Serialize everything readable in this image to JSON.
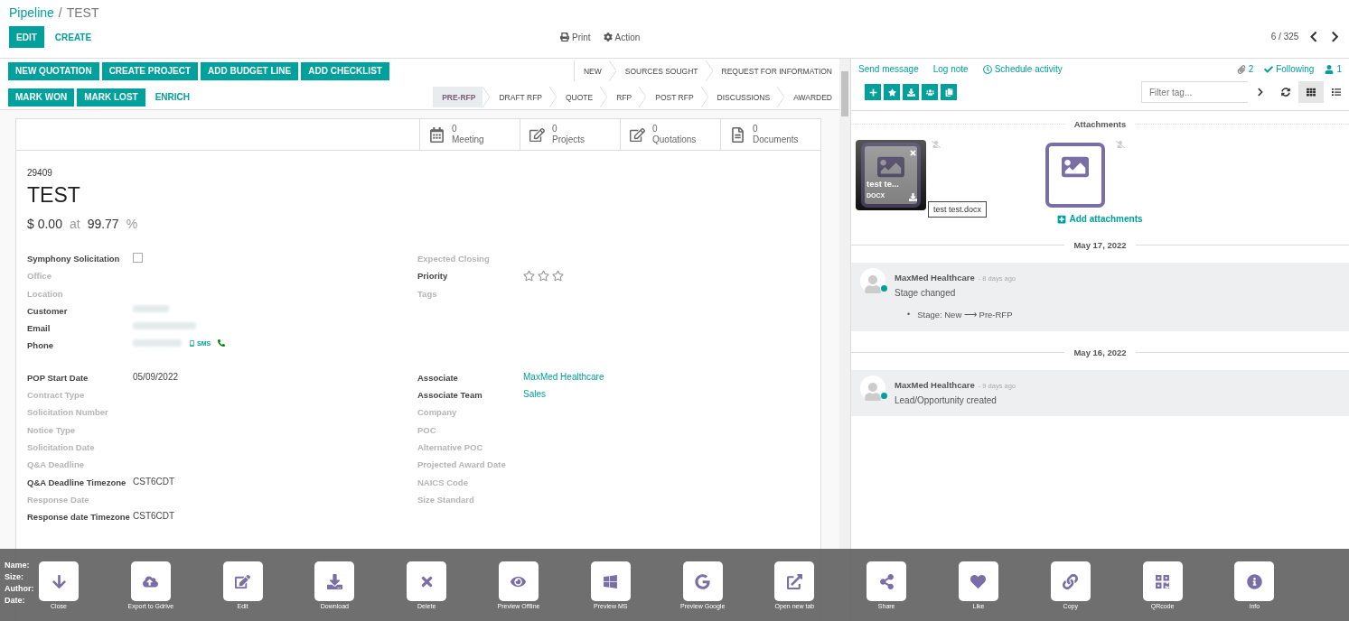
{
  "breadcrumb": {
    "parent": "Pipeline",
    "separator": "/",
    "current": "TEST"
  },
  "toolbar": {
    "buttons": [
      {
        "label": "EDIT",
        "kind": "primary"
      },
      {
        "label": "CREATE",
        "kind": "link"
      }
    ],
    "actions": [
      {
        "label": "Print",
        "kind": "print"
      },
      {
        "label": "Action",
        "kind": "gear"
      }
    ],
    "pager": "6 / 325"
  },
  "action_rows": [
    [
      {
        "label": "NEW QUOTATION",
        "kind": "primary"
      },
      {
        "label": "CREATE PROJECT",
        "kind": "primary"
      },
      {
        "label": "ADD BUDGET LINE",
        "kind": "primary"
      },
      {
        "label": "ADD CHECKLIST",
        "kind": "primary"
      }
    ],
    [
      {
        "label": "MARK WON",
        "kind": "primary"
      },
      {
        "label": "MARK LOST",
        "kind": "primary"
      },
      {
        "label": "ENRICH",
        "kind": "link"
      }
    ]
  ],
  "stage_rows": [
    [
      {
        "label": "NEW",
        "selected": false
      },
      {
        "label": "SOURCES SOUGHT",
        "selected": false
      },
      {
        "label": "REQUEST FOR INFORMATION",
        "selected": false
      }
    ],
    [
      {
        "label": "PRE-RFP",
        "selected": true
      },
      {
        "label": "DRAFT RFP",
        "selected": false
      },
      {
        "label": "QUOTE",
        "selected": false
      },
      {
        "label": "RFP",
        "selected": false
      },
      {
        "label": "POST RFP",
        "selected": false
      },
      {
        "label": "DISCUSSIONS",
        "selected": false
      },
      {
        "label": "AWARDED",
        "selected": false
      }
    ]
  ],
  "smart_buttons": [
    {
      "count": "0",
      "label": "Meeting",
      "kind": "calendar"
    },
    {
      "count": "0",
      "label": "Projects",
      "kind": "edit"
    },
    {
      "count": "0",
      "label": "Quotations",
      "kind": "edit"
    },
    {
      "count": "0",
      "label": "Documents",
      "kind": "document"
    }
  ],
  "record": {
    "id": "29409",
    "title": "TEST",
    "amount": "$ 0.00",
    "at": "at",
    "probability": "99.77",
    "percent": "%"
  },
  "field_groups": [
    {
      "left": [
        {
          "label": "Symphony Solicitation",
          "set": true,
          "kind": "checkbox",
          "checked": false
        },
        {
          "label": "Office",
          "set": false,
          "kind": "empty"
        },
        {
          "label": "Location",
          "set": false,
          "kind": "empty"
        },
        {
          "label": "Customer",
          "set": true,
          "kind": "redacted"
        },
        {
          "label": "Email",
          "set": true,
          "kind": "redacted"
        },
        {
          "label": "Phone",
          "set": true,
          "kind": "phone",
          "sms": "SMS"
        }
      ],
      "right": [
        {
          "label": "Expected Closing",
          "set": false,
          "kind": "empty"
        },
        {
          "label": "Priority",
          "set": true,
          "kind": "stars",
          "stars": 0
        },
        {
          "label": "Tags",
          "set": false,
          "kind": "empty"
        }
      ]
    },
    {
      "left": [
        {
          "label": "POP Start Date",
          "set": true,
          "kind": "text",
          "value": "05/09/2022"
        },
        {
          "label": "Contract Type",
          "set": false,
          "kind": "empty"
        },
        {
          "label": "Solicitation Number",
          "set": false,
          "kind": "empty"
        },
        {
          "label": "Notice Type",
          "set": false,
          "kind": "empty"
        },
        {
          "label": "Solicitation Date",
          "set": false,
          "kind": "empty"
        },
        {
          "label": "Q&A Deadline",
          "set": false,
          "kind": "empty"
        },
        {
          "label": "Q&A Deadline Timezone",
          "set": true,
          "kind": "text",
          "value": "CST6CDT"
        },
        {
          "label": "Response Date",
          "set": false,
          "kind": "empty"
        },
        {
          "label": "Response date Timezone",
          "set": true,
          "kind": "text",
          "value": "CST6CDT"
        }
      ],
      "right": [
        {
          "label": "Associate",
          "set": true,
          "kind": "link",
          "value": "MaxMed Healthcare"
        },
        {
          "label": "Associate Team",
          "set": true,
          "kind": "link",
          "value": "Sales"
        },
        {
          "label": "Company",
          "set": false,
          "kind": "empty"
        },
        {
          "label": "POC",
          "set": false,
          "kind": "empty"
        },
        {
          "label": "Alternative POC",
          "set": false,
          "kind": "empty"
        },
        {
          "label": "Projected Award Date",
          "set": false,
          "kind": "empty"
        },
        {
          "label": "NAICS Code",
          "set": false,
          "kind": "empty"
        },
        {
          "label": "Size Standard",
          "set": false,
          "kind": "empty"
        }
      ]
    }
  ],
  "chatter": {
    "actions": [
      {
        "label": "Send message",
        "kind": "plain"
      },
      {
        "label": "Log note",
        "kind": "plain"
      },
      {
        "label": "Schedule activity",
        "kind": "clock"
      }
    ],
    "attachments_count": "2",
    "following": "Following",
    "followers_count": "1",
    "tools": [
      {
        "kind": "plus"
      },
      {
        "kind": "star"
      },
      {
        "kind": "download"
      },
      {
        "kind": "users"
      },
      {
        "kind": "copy"
      }
    ],
    "filter_placeholder": "Filter tag...",
    "views": [
      {
        "kind": "grid",
        "selected": true
      },
      {
        "kind": "list",
        "selected": false
      }
    ],
    "attachments_title": "Attachments",
    "attachments": [
      {
        "name": "test te...",
        "type": "DOCX",
        "tooltip": "test test.docx",
        "selected": true
      },
      {
        "selected": false
      }
    ],
    "add_attachments": "Add attachments",
    "groups": [
      {
        "date": "May 17, 2022",
        "messages": [
          {
            "author": "MaxMed Healthcare",
            "time": "- 8 days ago",
            "body": "Stage changed",
            "online": true,
            "changes": [
              {
                "bullet": "•",
                "text": "Stage: New ⟶ Pre-RFP"
              }
            ]
          }
        ]
      },
      {
        "date": "May 16, 2022",
        "messages": [
          {
            "author": "MaxMed Healthcare",
            "time": "- 9 days ago",
            "body": "Lead/Opportunity created",
            "online": true
          }
        ]
      }
    ]
  },
  "viewer": {
    "info": [
      "Name:",
      "Size:",
      "Author:",
      "Date:"
    ],
    "buttons": [
      {
        "label": "Close",
        "kind": "down"
      },
      {
        "label": "Export to Gdrive",
        "kind": "cloud"
      },
      {
        "label": "Edit",
        "kind": "edit"
      },
      {
        "label": "Download",
        "kind": "download"
      },
      {
        "label": "Delete",
        "kind": "delete"
      },
      {
        "label": "Preview Offline",
        "kind": "eye"
      },
      {
        "label": "Preview MS",
        "kind": "windows"
      },
      {
        "label": "Preview Google",
        "kind": "google"
      },
      {
        "label": "Open new tab",
        "kind": "external"
      },
      {
        "label": "Share",
        "kind": "share"
      },
      {
        "label": "Like",
        "kind": "heart"
      },
      {
        "label": "Copy",
        "kind": "link"
      },
      {
        "label": "QRcode",
        "kind": "qr"
      },
      {
        "label": "Info",
        "kind": "info"
      }
    ]
  }
}
